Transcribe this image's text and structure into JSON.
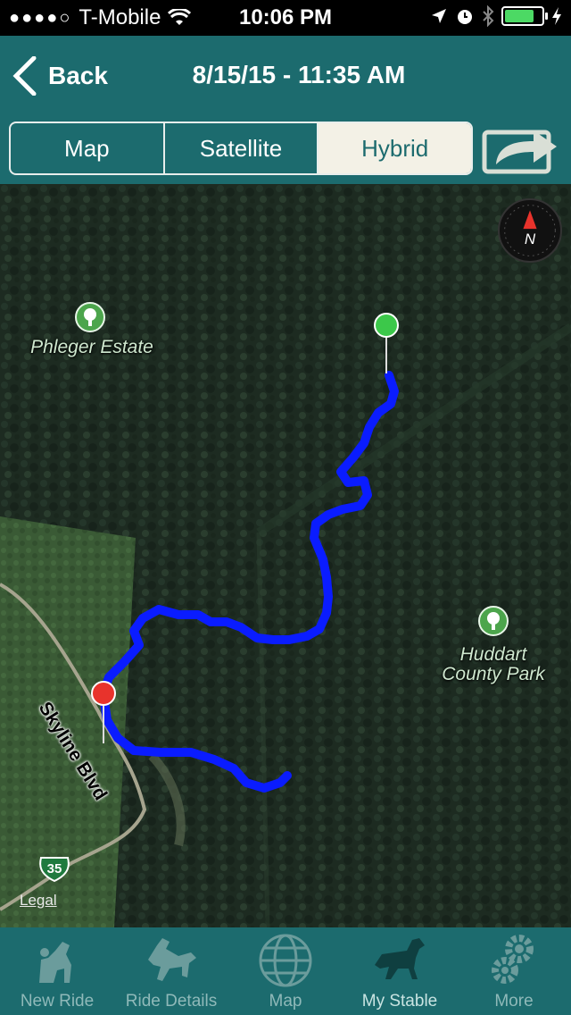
{
  "status_bar": {
    "carrier": "T-Mobile",
    "time": "10:06 PM",
    "battery_level": 0.8
  },
  "nav": {
    "back_label": "Back",
    "title": "8/15/15 - 11:35 AM"
  },
  "map_types": {
    "options": [
      "Map",
      "Satellite",
      "Hybrid"
    ],
    "selected": "Hybrid"
  },
  "map": {
    "labels": {
      "phleger": "Phleger Estate",
      "huddart_line1": "Huddart",
      "huddart_line2": "County Park",
      "road": "Skyline Blvd",
      "highway": "35",
      "legal": "Legal"
    },
    "compass_label": "N",
    "route_color": "#0a1cff",
    "start_pin_color": "#e8332c",
    "end_pin_color": "#3cc84a"
  },
  "tabs": [
    {
      "label": "New Ride",
      "icon": "new-ride-icon"
    },
    {
      "label": "Ride Details",
      "icon": "ride-details-icon"
    },
    {
      "label": "Map",
      "icon": "globe-icon"
    },
    {
      "label": "My Stable",
      "icon": "horse-icon"
    },
    {
      "label": "More",
      "icon": "gears-icon"
    }
  ],
  "active_tab": "My Stable"
}
